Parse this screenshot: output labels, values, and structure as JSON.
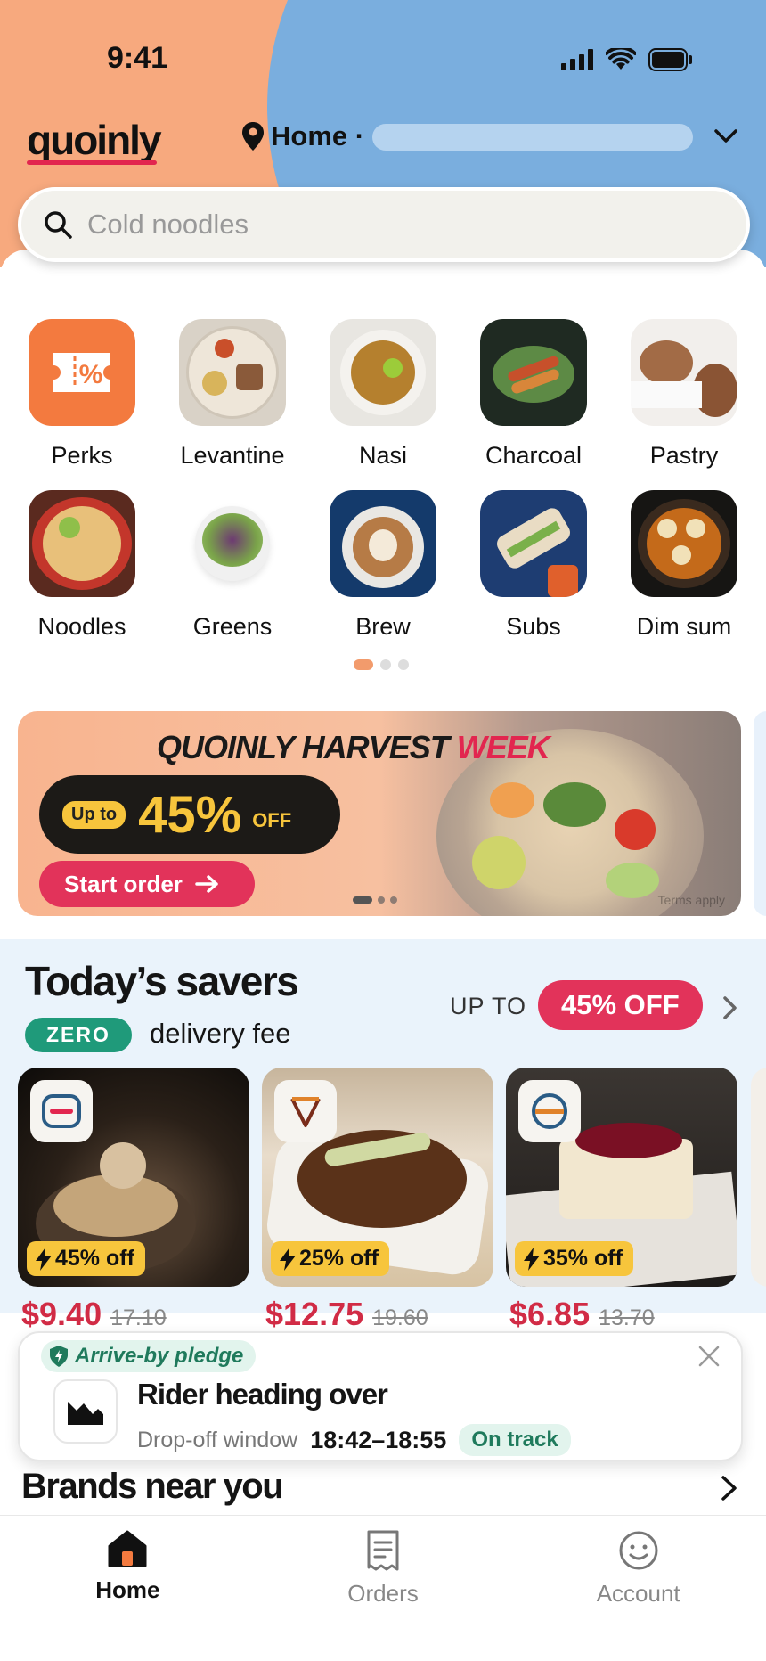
{
  "status_bar": {
    "time": "9:41"
  },
  "header": {
    "logo": "quoinly",
    "location_label": "Home ·",
    "search_placeholder": "Cold noodles"
  },
  "categories": [
    {
      "label": "Perks",
      "icon": "ticket-percent-icon"
    },
    {
      "label": "Levantine"
    },
    {
      "label": "Nasi"
    },
    {
      "label": "Charcoal"
    },
    {
      "label": "Pastry"
    },
    {
      "label": "Noodles"
    },
    {
      "label": "Greens"
    },
    {
      "label": "Brew"
    },
    {
      "label": "Subs"
    },
    {
      "label": "Dim sum"
    }
  ],
  "banner": {
    "title_main": "QUOINLY HARVEST",
    "title_accent": "WEEK",
    "up_to": "Up to",
    "percent": "45%",
    "off": "OFF",
    "cta": "Start order",
    "terms": "Terms apply"
  },
  "savers": {
    "title": "Today’s savers",
    "zero": "ZERO",
    "fee": "delivery fee",
    "up_to": "UP TO",
    "badge": "45% OFF",
    "deals": [
      {
        "discount": "45% off",
        "price": "$9.40",
        "was": "17.10"
      },
      {
        "discount": "25% off",
        "price": "$12.75",
        "was": "19.60"
      },
      {
        "discount": "35% off",
        "price": "$6.85",
        "was": "13.70"
      }
    ]
  },
  "notification": {
    "pledge": "Arrive-by pledge",
    "title": "Rider heading over",
    "window_label": "Drop-off window",
    "window": "18:42–18:55",
    "status": "On track"
  },
  "brands_title": "Brands near you",
  "tabs": [
    {
      "label": "Home",
      "icon": "home-icon",
      "active": true
    },
    {
      "label": "Orders",
      "icon": "receipt-icon",
      "active": false
    },
    {
      "label": "Account",
      "icon": "smiley-icon",
      "active": false
    }
  ],
  "colors": {
    "accent": "#e2264f",
    "peach": "#f7a97e",
    "sky": "#7aaede",
    "promo_yellow": "#f7c53c",
    "green": "#1f9a7a"
  }
}
